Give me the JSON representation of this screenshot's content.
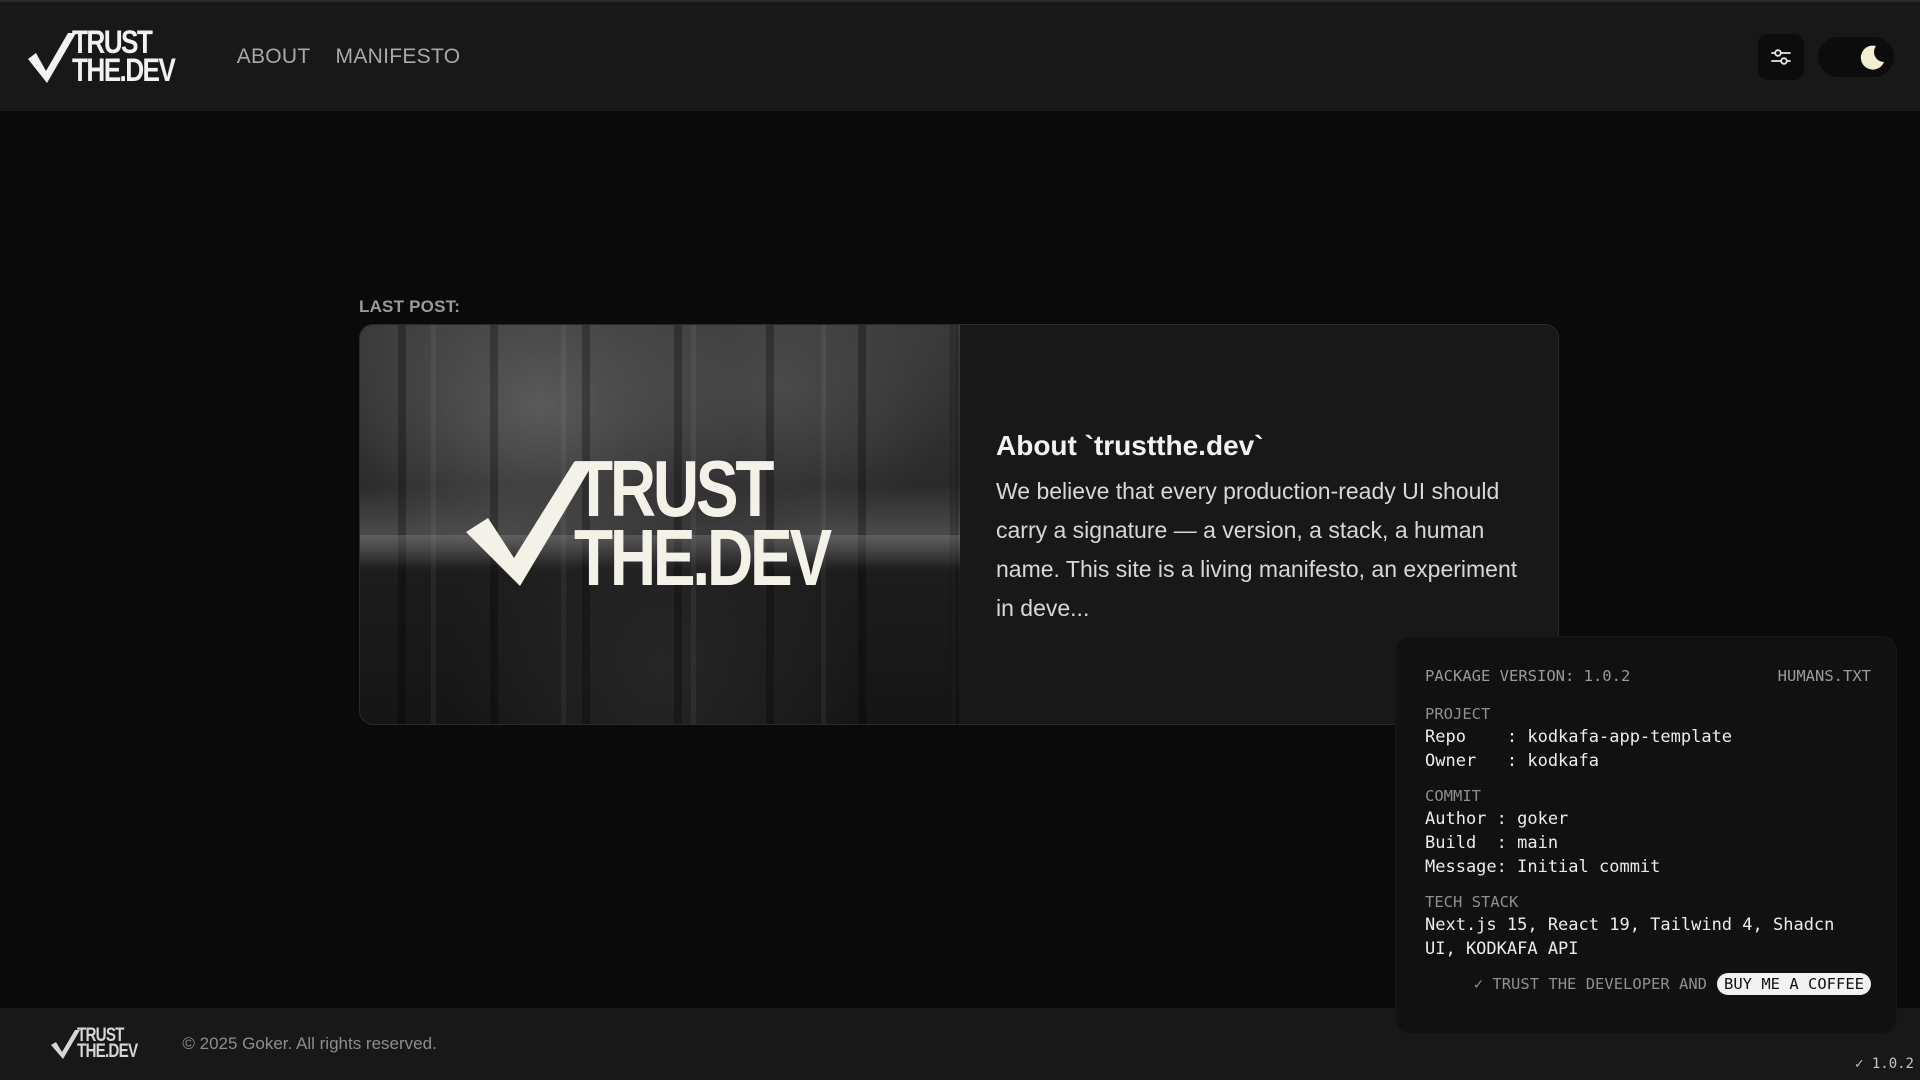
{
  "header": {
    "logo_line1": "TRUST",
    "logo_line2": "THE.DEV",
    "nav": [
      {
        "label": "ABOUT"
      },
      {
        "label": "MANIFESTO"
      }
    ],
    "settings_icon": "sliders-icon",
    "theme_icon": "moon-icon"
  },
  "main": {
    "last_post_label": "LAST POST:",
    "post": {
      "image_logo_line1": "TRUST",
      "image_logo_line2": "THE.DEV",
      "title": "About `trustthe.dev`",
      "excerpt": "We believe that every production-ready UI should carry a signature — a version, a stack, a human name. This site is a living manifesto, an experiment in deve..."
    }
  },
  "footer": {
    "logo_line1": "TRUST",
    "logo_line2": "THE.DEV",
    "copyright": "© 2025 Goker. All rights reserved."
  },
  "humans_panel": {
    "package_version": "PACKAGE VERSION: 1.0.2",
    "humans_link": "HUMANS.TXT",
    "project_head": "PROJECT",
    "repo": "Repo    : kodkafa-app-template",
    "owner": "Owner   : kodkafa",
    "commit_head": "COMMIT",
    "author": "Author : goker",
    "build": "Build  : main",
    "message": "Message: Initial commit",
    "tech_head": "TECH STACK",
    "tech": "Next.js 15, React 19, Tailwind 4, Shadcn UI, KODKAFA API",
    "foot_text": "✓ TRUST THE DEVELOPER AND",
    "coffee": "BUY ME A COFFEE"
  },
  "version_badge": "✓ 1.0.2",
  "colors": {
    "background": "#0a0a0a",
    "header": "#181818",
    "card": "#181818",
    "logo_cream": "#f3f1e8"
  }
}
